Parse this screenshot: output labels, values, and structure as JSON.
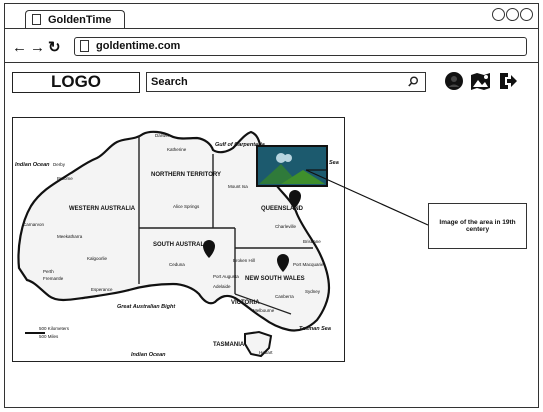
{
  "browser": {
    "tab_title": "GoldenTime",
    "url": "goldentime.com"
  },
  "header": {
    "logo_text": "LOGO",
    "search_placeholder": "Search",
    "icons": [
      "user-icon",
      "map-image-icon",
      "logout-icon"
    ]
  },
  "map": {
    "labels": {
      "western_australia": "WESTERN AUSTRALIA",
      "northern_territory": "NORTHERN TERRITORY",
      "queensland": "QUEENSLAND",
      "south_australia": "SOUTH AUSTRALIA",
      "new_south_wales": "NEW SOUTH WALES",
      "victoria": "VICTORIA",
      "tasmania": "TASMANIA",
      "indian_ocean_left": "Indian Ocean",
      "indian_ocean_bottom": "Indian Ocean",
      "great_bight": "Great Australian Bight",
      "tasman_sea": "Tasman Sea",
      "sea": "Sea",
      "gulf": "Gulf of Carpentaria",
      "darwin": "Darwin",
      "katherine": "Katherine",
      "derby": "Derby",
      "broome": "Broome",
      "carnarvon": "Carnarvon",
      "meekatharra": "Meekatharra",
      "kalgoorlie": "Kalgoorlie",
      "perth": "Perth",
      "fremantle": "Fremantle",
      "esperance": "Esperance",
      "alice_springs": "Alice Springs",
      "mount_isa": "Mount Isa",
      "charleville": "Charleville",
      "brisbane": "Brisbane",
      "ceduna": "Ceduna",
      "broken_hill": "Broken Hill",
      "port_macquarie": "Port Macquarie",
      "sydney": "Sydney",
      "canberra": "Canberra",
      "melbourne": "Melbourne",
      "port_augusta": "Port Augusta",
      "adelaide": "Adelaide",
      "hobart": "Hobart",
      "scale_km": "500 Kilometers",
      "scale_mi": "500 Miles"
    }
  },
  "annotation": {
    "note": "Image of the area in 19th centery"
  }
}
